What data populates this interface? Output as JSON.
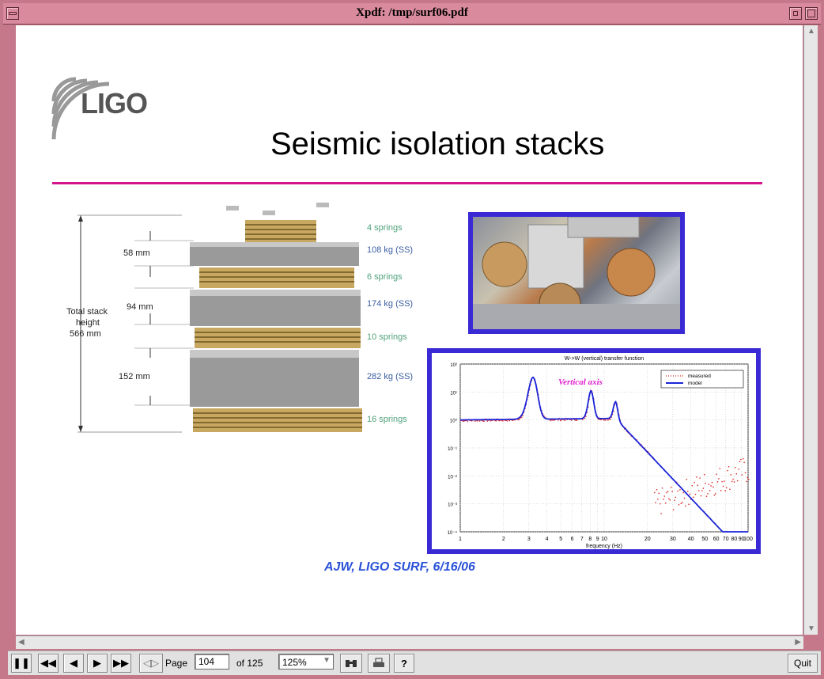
{
  "window": {
    "title": "Xpdf: /tmp/surf06.pdf"
  },
  "slide": {
    "logo_text": "LIGO",
    "title": "Seismic isolation stacks",
    "credit": "AJW, LIGO SURF, 6/16/06",
    "stack": {
      "total_label_1": "Total stack",
      "total_label_2": "height",
      "total_label_3": "566 mm",
      "dim_58": "58 mm",
      "dim_94": "94 mm",
      "dim_152": "152 mm",
      "levels": [
        "4 springs",
        "108 kg (SS)",
        "6 springs",
        "174 kg (SS)",
        "10 springs",
        "282 kg (SS)",
        "16 springs"
      ]
    },
    "plot": {
      "title": "W->W (vertical) transfer function",
      "annotation": "Vertical axis",
      "legend": [
        "measured",
        "model"
      ],
      "xlabel": "frequency (Hz)",
      "xticks": [
        "1",
        "2",
        "3",
        "4",
        "5",
        "6",
        "7",
        "8",
        "9",
        "10",
        "20",
        "30",
        "40",
        "50",
        "60",
        "70",
        "80",
        "90",
        "100"
      ],
      "yticks": [
        "10²",
        "10¹",
        "10⁰",
        "10⁻¹",
        "10⁻²",
        "10⁻³",
        "10⁻⁴"
      ],
      "colors": {
        "measured": "#e02020",
        "model": "#1a24d8"
      }
    }
  },
  "toolbar": {
    "page_label": "Page",
    "page_value": "104",
    "of_label": "of 125",
    "zoom_value": "125%",
    "quit_label": "Quit"
  },
  "colors": {
    "accent_rule": "#d4148c",
    "frame": "#3a2ad6",
    "credit": "#2a52d8"
  }
}
